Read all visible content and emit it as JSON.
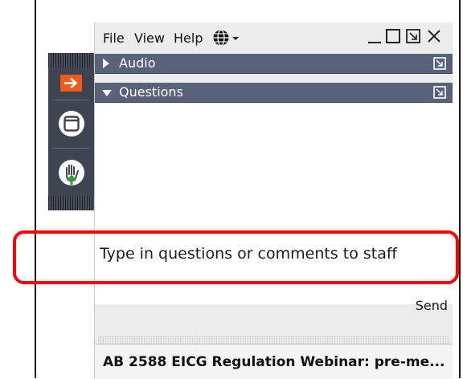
{
  "menu": {
    "file": "File",
    "view": "View",
    "help": "Help"
  },
  "icons": {
    "globe": "globe-icon",
    "arrow": "arrow-right-icon",
    "window": "window-icon",
    "hand": "raise-hand-icon",
    "popout": "popout-icon"
  },
  "colors": {
    "section_bar": "#58627a",
    "side_strip": "#3f4550",
    "arrow_button": "#f05a1a",
    "hand_green": "#2e9e3e",
    "highlight": "#ff0000"
  },
  "sections": {
    "audio": {
      "label": "Audio",
      "expanded": false
    },
    "questions": {
      "label": "Questions",
      "expanded": true
    }
  },
  "question_input": {
    "placeholder": "Type in questions or comments to staff"
  },
  "send_label": "Send",
  "footer": {
    "title": "AB 2588 EICG Regulation Webinar: pre-me..."
  }
}
